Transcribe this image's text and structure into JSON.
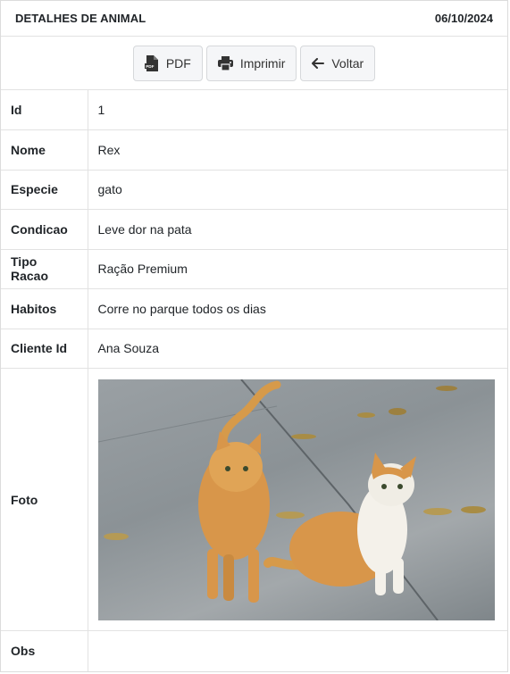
{
  "header": {
    "title": "DETALHES DE ANIMAL",
    "date": "06/10/2024"
  },
  "toolbar": {
    "pdf_label": "PDF",
    "print_label": "Imprimir",
    "back_label": "Voltar"
  },
  "fields": [
    {
      "label": "Id",
      "value": "1"
    },
    {
      "label": "Nome",
      "value": "Rex"
    },
    {
      "label": "Especie",
      "value": "gato"
    },
    {
      "label": "Condicao",
      "value": "Leve dor na pata"
    },
    {
      "label": "Tipo Racao",
      "value": "Ração Premium"
    },
    {
      "label": "Habitos",
      "value": "Corre no parque todos os dias"
    },
    {
      "label": "Cliente Id",
      "value": "Ana Souza"
    }
  ],
  "photo_label": "Foto",
  "obs": {
    "label": "Obs",
    "value": ""
  },
  "colors": {
    "border": "#e2e2e2",
    "button_bg": "#f5f6f8",
    "text": "#212529"
  }
}
